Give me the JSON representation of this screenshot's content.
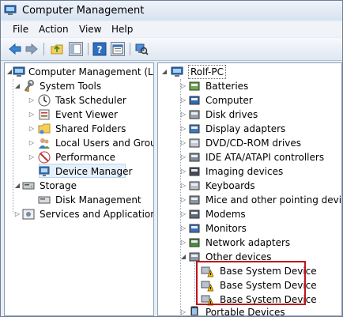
{
  "window": {
    "title": "Computer Management"
  },
  "menu": [
    "File",
    "Action",
    "View",
    "Help"
  ],
  "toolbar": {
    "icons": [
      "back-arrow-icon",
      "forward-arrow-icon",
      "up-folder-icon",
      "show-hide-tree-icon",
      "help-icon",
      "properties-icon",
      "scan-hardware-icon"
    ]
  },
  "left_tree": {
    "root": "Computer Management (Local",
    "system_tools": "System Tools",
    "task_scheduler": "Task Scheduler",
    "event_viewer": "Event Viewer",
    "shared_folders": "Shared Folders",
    "local_users": "Local Users and Groups",
    "performance": "Performance",
    "device_manager": "Device Manager",
    "storage": "Storage",
    "disk_management": "Disk Management",
    "services": "Services and Applications"
  },
  "device_tree": {
    "root": "Rolf-PC",
    "categories": [
      "Batteries",
      "Computer",
      "Disk drives",
      "Display adapters",
      "DVD/CD-ROM drives",
      "IDE ATA/ATAPI controllers",
      "Imaging devices",
      "Keyboards",
      "Mice and other pointing devices",
      "Modems",
      "Monitors",
      "Network adapters",
      "Other devices"
    ],
    "other_devices": [
      "Base System Device",
      "Base System Device",
      "Base System Device"
    ],
    "after": [
      "Portable Devices"
    ]
  },
  "colors": {
    "highlight_box": "#c0141c",
    "selection": "#e5f0fb",
    "warning": "#f2c200"
  }
}
